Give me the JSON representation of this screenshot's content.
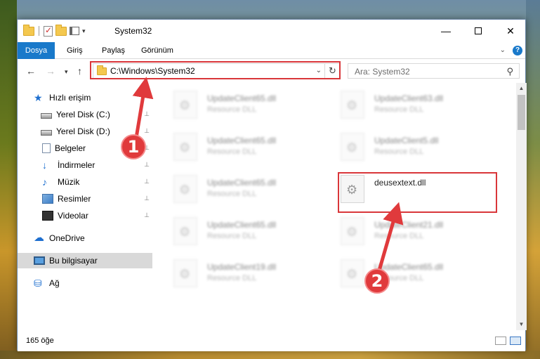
{
  "window": {
    "title": "System32",
    "minimize_label": "—",
    "maximize_label": "",
    "close_label": "✕"
  },
  "ribbon": {
    "tabs": [
      "Dosya",
      "Giriş",
      "Paylaş",
      "Görünüm"
    ],
    "expand_label": "⌄",
    "help_label": "?"
  },
  "navigation": {
    "back_label": "←",
    "forward_label": "→",
    "recent_label": "▾",
    "up_label": "↑",
    "address": "C:\\Windows\\System32",
    "address_dropdown": "⌄",
    "refresh_label": "↻",
    "search_placeholder": "Ara: System32",
    "search_icon_label": "⚲"
  },
  "sidebar": {
    "items": [
      {
        "label": "Hızlı erişim",
        "icon": "star-icon",
        "pinned": false
      },
      {
        "label": "Yerel Disk (C:)",
        "icon": "disk-icon",
        "pinned": true
      },
      {
        "label": "Yerel Disk (D:)",
        "icon": "disk-icon",
        "pinned": true
      },
      {
        "label": "Belgeler",
        "icon": "documents-icon",
        "pinned": true
      },
      {
        "label": "İndirmeler",
        "icon": "downloads-icon",
        "pinned": true
      },
      {
        "label": "Müzik",
        "icon": "music-icon",
        "pinned": true
      },
      {
        "label": "Resimler",
        "icon": "pictures-icon",
        "pinned": true
      },
      {
        "label": "Videolar",
        "icon": "videos-icon",
        "pinned": true
      },
      {
        "label": "OneDrive",
        "icon": "onedrive-icon",
        "pinned": false
      },
      {
        "label": "Bu bilgisayar",
        "icon": "this-pc-icon",
        "pinned": false,
        "selected": true
      },
      {
        "label": "Ağ",
        "icon": "network-icon",
        "pinned": false
      }
    ],
    "pin_glyph": "📌"
  },
  "files": [
    {
      "name": "UpdateClient65.dll",
      "type": "Resource DLL"
    },
    {
      "name": "UpdateClient63.dll",
      "type": "Resource DLL"
    },
    {
      "name": "UpdateClient65.dll",
      "type": "Resource DLL"
    },
    {
      "name": "UpdateClient5.dll",
      "type": "Resource DLL"
    },
    {
      "name": "UpdateClient65.dll",
      "type": "Resource DLL"
    },
    {
      "name": "deusextext.dll",
      "type": ""
    },
    {
      "name": "UpdateClient65.dll",
      "type": "Resource DLL"
    },
    {
      "name": "UpdateClient21.dll",
      "type": "Resource DLL"
    },
    {
      "name": "UpdateClient19.dll",
      "type": "Resource DLL"
    },
    {
      "name": "UpdateClient65.dll",
      "type": "Resource DLL"
    }
  ],
  "status": {
    "item_count": "165 öğe"
  },
  "annotations": {
    "badge_1": "1",
    "badge_2": "2",
    "color": "#e03a3c"
  }
}
